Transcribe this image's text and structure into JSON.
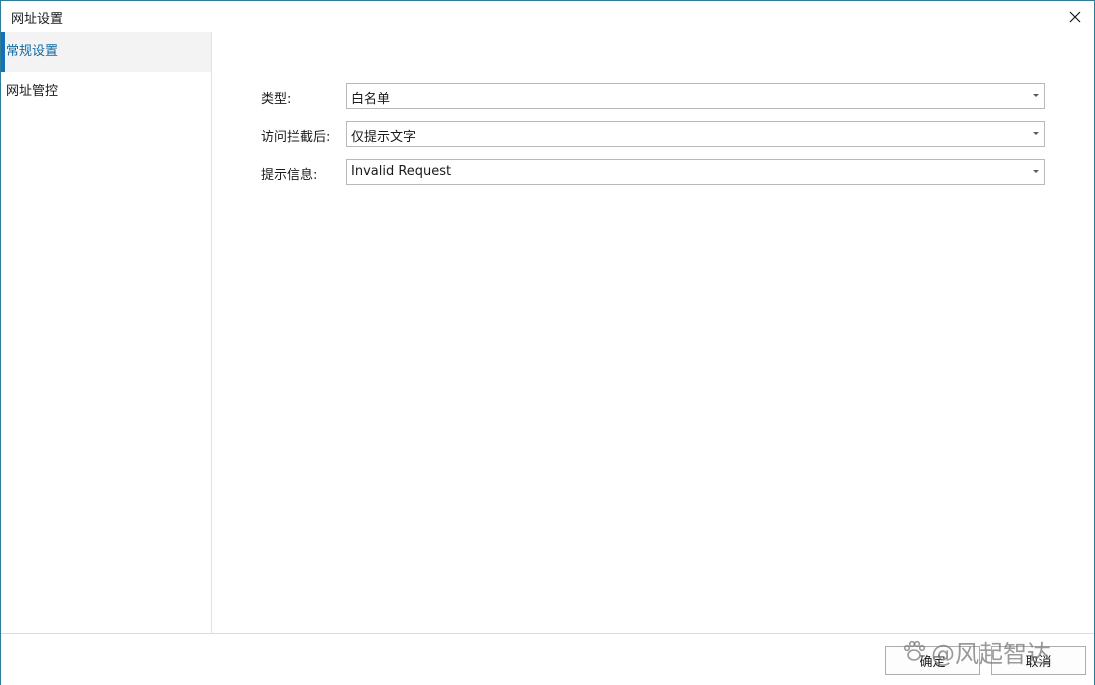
{
  "window": {
    "title": "网址设置"
  },
  "sidebar": {
    "items": [
      {
        "label": "常规设置",
        "active": true
      },
      {
        "label": "网址管控",
        "active": false
      }
    ]
  },
  "form": {
    "type": {
      "label": "类型:",
      "value": "白名单"
    },
    "after_block": {
      "label": "访问拦截后:",
      "value": "仅提示文字"
    },
    "message": {
      "label": "提示信息:",
      "value": "Invalid Request"
    }
  },
  "footer": {
    "ok_label": "确定",
    "cancel_label": "取消"
  },
  "watermark": {
    "text": "@风起智达"
  },
  "colors": {
    "accent": "#1570b5",
    "active_text": "#0f6aa3",
    "window_border": "#2d7d9a"
  }
}
